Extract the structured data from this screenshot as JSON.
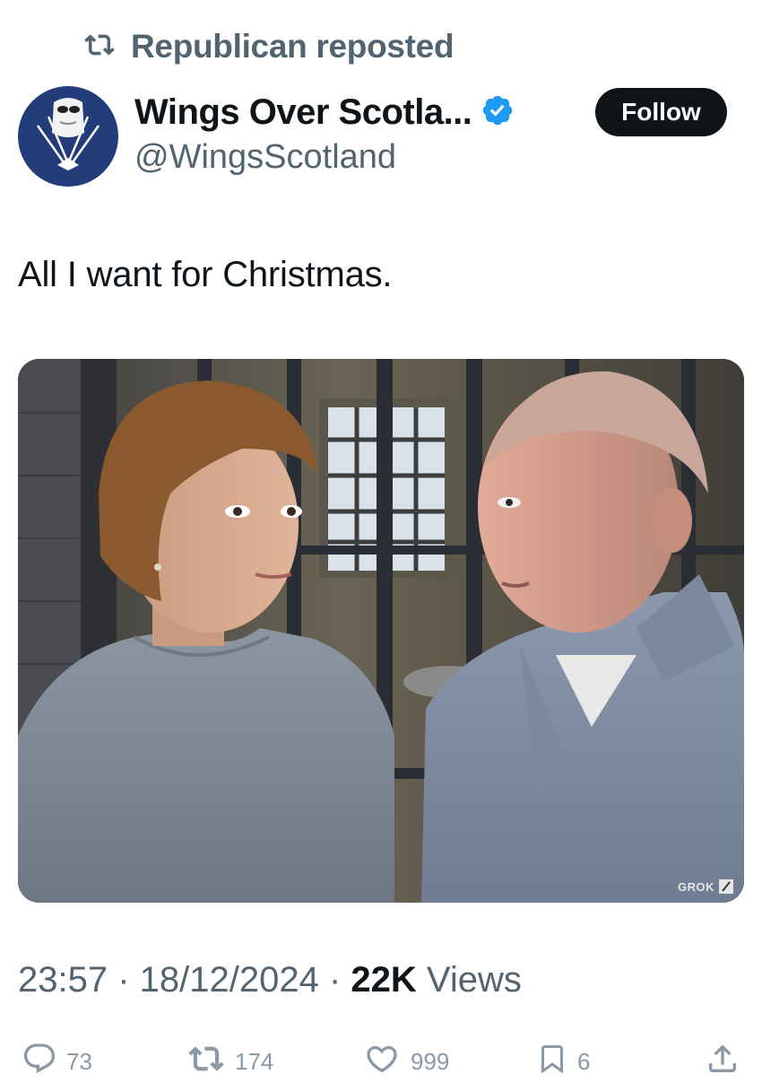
{
  "repost": {
    "label": "Republican reposted"
  },
  "author": {
    "name": "Wings Over Scotla...",
    "handle": "@WingsScotland",
    "verified": true
  },
  "follow": {
    "label": "Follow"
  },
  "tweet": {
    "text": "All I want for Christmas."
  },
  "media": {
    "watermark": "GROK"
  },
  "meta": {
    "time": "23:57",
    "sep1": " · ",
    "date": "18/12/2024",
    "sep2": " · ",
    "views_count": "22K",
    "views_label": " Views"
  },
  "actions": {
    "replies": "73",
    "reposts": "174",
    "likes": "999",
    "bookmarks": "6"
  },
  "colors": {
    "text": "#0f1419",
    "secondary": "#536471",
    "verified": "#1d9bf0",
    "follow_bg": "#0f1419",
    "avatar_bg": "#233c7a"
  }
}
